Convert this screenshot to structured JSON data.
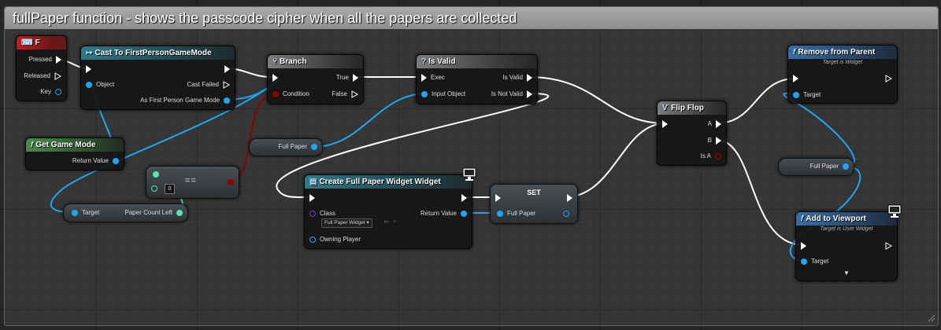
{
  "comment": {
    "title": "fullPaper function - shows the passcode cipher when all the papers are collected"
  },
  "nodes": {
    "input_f": {
      "title": "F",
      "pressed": "Pressed",
      "released": "Released",
      "key": "Key"
    },
    "cast": {
      "title": "Cast To FirstPersonGameMode",
      "object": "Object",
      "cast_failed": "Cast Failed",
      "as_mode": "As First Person Game Mode"
    },
    "branch": {
      "title": "Branch",
      "condition": "Condition",
      "true": "True",
      "false": "False"
    },
    "is_valid": {
      "title": "Is Valid",
      "exec": "Exec",
      "input_object": "Input Object",
      "is_valid": "Is Valid",
      "is_not_valid": "Is Not Valid"
    },
    "remove_parent": {
      "title": "Remove from Parent",
      "subtitle": "Target is Widget",
      "target": "Target"
    },
    "flip_flop": {
      "title": "Flip Flop",
      "a": "A",
      "b": "B",
      "is_a": "Is A"
    },
    "get_game_mode": {
      "title": "Get Game Mode",
      "return_value": "Return Value"
    },
    "full_paper_get_1": {
      "label": "Full Paper"
    },
    "full_paper_get_2": {
      "label": "Full Paper"
    },
    "equals": {
      "label": "==",
      "value": "0"
    },
    "target_getter": {
      "target": "Target",
      "paper_count_left": "Paper Count Left"
    },
    "create_widget": {
      "title": "Create Full Paper Widget Widget",
      "class": "Class",
      "class_value": "Full Paper Widget",
      "owning_player": "Owning Player",
      "return_value": "Return Value"
    },
    "set_node": {
      "title": "SET",
      "full_paper": "Full Paper"
    },
    "add_viewport": {
      "title": "Add to Viewport",
      "subtitle": "Target is User Widget",
      "target": "Target"
    }
  },
  "colors": {
    "exec_wire": "#ffffff",
    "object_wire": "#1ea7f0",
    "bool_wire": "#8e0000",
    "int_pin": "#52e6b0",
    "class_pin": "#6b3dc4"
  }
}
